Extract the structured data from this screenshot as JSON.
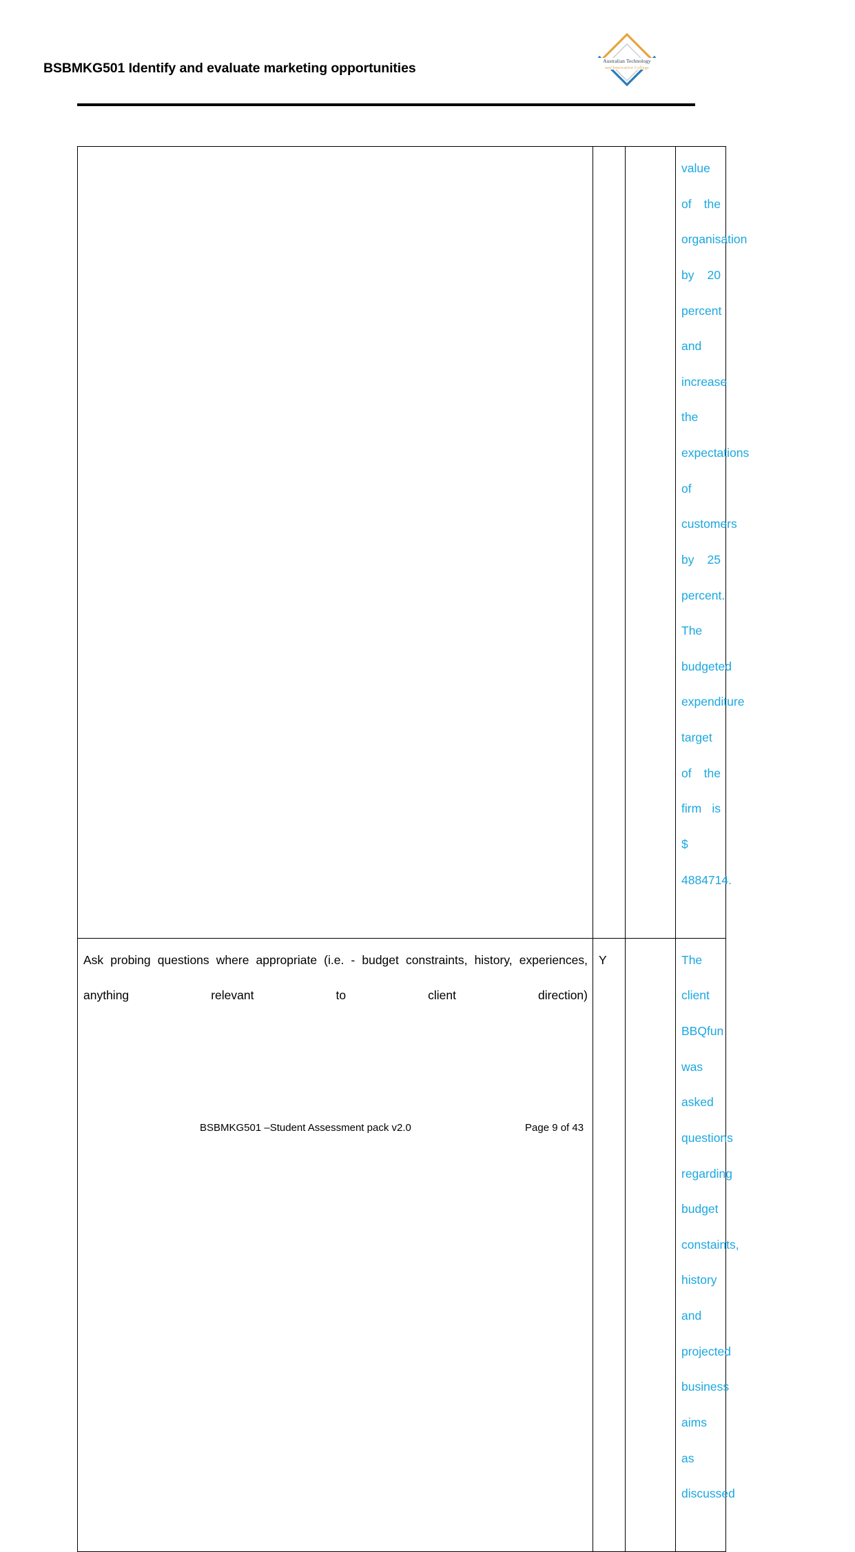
{
  "header": {
    "title": "BSBMKG501 Identify and evaluate marketing opportunities",
    "logo": {
      "name": "australian-technology-and-innovation-college-logo",
      "line1": "Australian Technology",
      "line2": "and Innovation College",
      "top_chevron_color": "#e8a33d",
      "bottom_chevron_color": "#2b7bb9",
      "inner_chevron_color": "#b9c4d4",
      "text_color": "#2c3b55",
      "subtext_color": "#e0a963"
    },
    "rule_color": "#000000"
  },
  "table": {
    "comment_text_color": "#1ba7e0",
    "border_color": "#000000",
    "columns": [
      {
        "key": "criteria",
        "label": ""
      },
      {
        "key": "yes_no",
        "label": ""
      },
      {
        "key": "blank",
        "label": ""
      },
      {
        "key": "comment",
        "label": ""
      }
    ],
    "rows": [
      {
        "name": "row-continued",
        "criteria": "",
        "yes_no": "",
        "blank": "",
        "comment": "value of the organisation by 20 percent and increase the expectations of customers by 25 percent. The budgeted expenditure target of the firm is $ 4884714."
      },
      {
        "name": "row-probing",
        "criteria": "Ask probing questions where appropriate (i.e. - budget constraints, history, experiences, anything relevant to client direction)",
        "yes_no": "Y",
        "blank": "",
        "comment": "The client BBQfun was asked questions regarding budget constaints, history and projected business aims as discussed"
      }
    ]
  },
  "footer": {
    "document_label": "BSBMKG501 –Student Assessment pack  v2.0",
    "page_number": "Page 9 of 43"
  }
}
